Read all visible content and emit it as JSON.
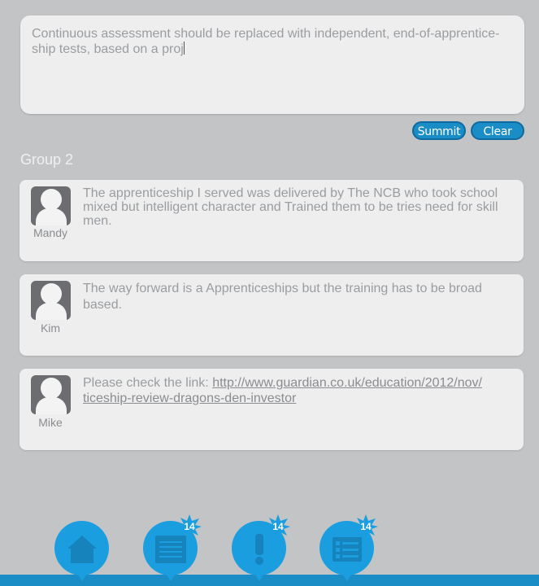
{
  "composer": {
    "text": "Continuous assessment should be replaced with independent, end-of-apprentice-ship tests, based on a proj"
  },
  "buttons": {
    "submit_label": "Summit",
    "clear_label": "Clear"
  },
  "group": {
    "title": "Group 2",
    "posts": [
      {
        "author": "Mandy",
        "text": "The apprenticeship I served was delivered by The NCB who took school mixed but intelligent character and Trained them to be tries need for skill men."
      },
      {
        "author": "Kim",
        "text": "The way forward is a Apprenticeships but the training has to be broad based."
      },
      {
        "author": "Mike",
        "text_prefix": "Please check the link: ",
        "link": "http://www.guardian.co.uk/education/2012/nov/ ticeship-review-dragons-den-investor"
      }
    ]
  },
  "nav": {
    "items": [
      {
        "icon": "home-icon",
        "badge": ""
      },
      {
        "icon": "document-icon",
        "badge": "14"
      },
      {
        "icon": "alert-icon",
        "badge": "14"
      },
      {
        "icon": "list-icon",
        "badge": "14"
      }
    ]
  },
  "colors": {
    "accent": "#1a8dc7",
    "background": "#c2c4c6",
    "card": "#eeeeef"
  }
}
